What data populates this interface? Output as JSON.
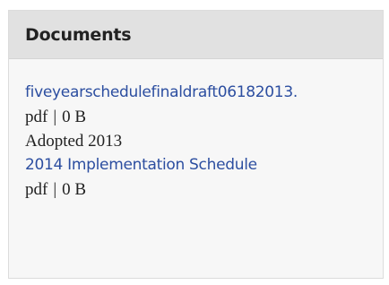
{
  "panel": {
    "title": "Documents"
  },
  "documents": [
    {
      "link_text": "fiveyearschedulefinaldraft06182013.",
      "file_type": "pdf",
      "separator": "|",
      "file_size": "0 B",
      "note": "Adopted 2013"
    },
    {
      "link_text": "2014 Implementation Schedule",
      "file_type": "pdf",
      "separator": "|",
      "file_size": "0 B"
    }
  ],
  "colors": {
    "link": "#2c4ea0",
    "header_bg": "#e1e1e1",
    "panel_bg": "#f7f7f7",
    "text": "#222222"
  }
}
